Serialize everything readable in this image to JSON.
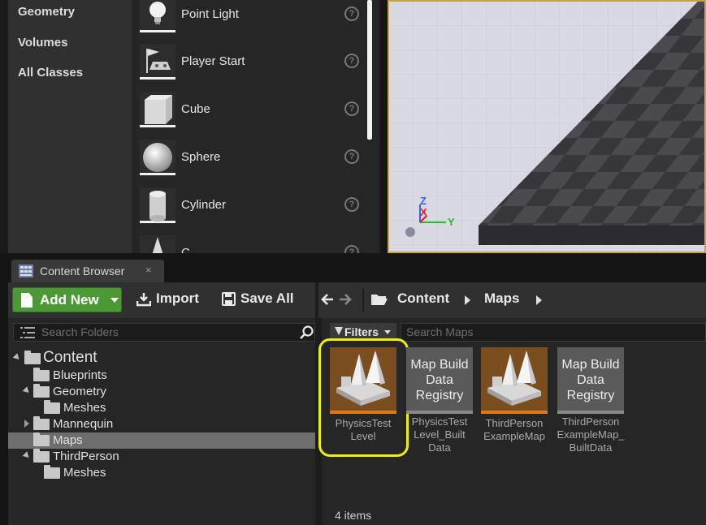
{
  "place_actors": {
    "categories": [
      "Geometry",
      "Volumes",
      "All Classes"
    ],
    "items": [
      {
        "label": "Point Light",
        "icon": "point-light-icon"
      },
      {
        "label": "Player Start",
        "icon": "player-start-icon"
      },
      {
        "label": "Cube",
        "icon": "cube-icon"
      },
      {
        "label": "Sphere",
        "icon": "sphere-icon"
      },
      {
        "label": "Cylinder",
        "icon": "cylinder-icon"
      },
      {
        "label": "C",
        "icon": "cone-icon"
      }
    ],
    "help_glyph": "?"
  },
  "viewport": {
    "axis_z": "Z",
    "axis_x": "X",
    "axis_y": "Y"
  },
  "content_browser": {
    "tab_title": "Content Browser",
    "tab_close": "×",
    "toolbar": {
      "add_new": "Add New",
      "import": "Import",
      "save_all": "Save All"
    },
    "breadcrumb": [
      "Content",
      "Maps"
    ],
    "folder_search_placeholder": "Search Folders",
    "asset_search_placeholder": "Search Maps",
    "filters_label": "Filters",
    "tree": [
      {
        "label": "Content",
        "depth": 0,
        "expanded": true,
        "selected": false
      },
      {
        "label": "Blueprints",
        "depth": 1,
        "expanded": null,
        "selected": false
      },
      {
        "label": "Geometry",
        "depth": 1,
        "expanded": true,
        "selected": false
      },
      {
        "label": "Meshes",
        "depth": 2,
        "expanded": null,
        "selected": false
      },
      {
        "label": "Mannequin",
        "depth": 1,
        "expanded": false,
        "selected": false
      },
      {
        "label": "Maps",
        "depth": 1,
        "expanded": null,
        "selected": true
      },
      {
        "label": "ThirdPerson",
        "depth": 1,
        "expanded": true,
        "selected": false
      },
      {
        "label": "Meshes",
        "depth": 2,
        "expanded": null,
        "selected": false
      }
    ],
    "assets": [
      {
        "kind": "map",
        "name_line1": "PhysicsTest",
        "name_line2": "Level",
        "name_line3": "",
        "bar_color": "#e07a10",
        "highlighted": true
      },
      {
        "kind": "registry",
        "thumb_line1": "Map Build",
        "thumb_line2": "Data",
        "thumb_line3": "Registry",
        "name_line1": "PhysicsTest",
        "name_line2": "Level_Built",
        "name_line3": "Data",
        "bar_color": "#888888",
        "highlighted": false
      },
      {
        "kind": "map",
        "name_line1": "ThirdPerson",
        "name_line2": "ExampleMap",
        "name_line3": "",
        "bar_color": "#e07a10",
        "highlighted": false
      },
      {
        "kind": "registry",
        "thumb_line1": "Map Build",
        "thumb_line2": "Data",
        "thumb_line3": "Registry",
        "name_line1": "ThirdPerson",
        "name_line2": "ExampleMap_",
        "name_line3": "BuiltData",
        "bar_color": "#888888",
        "highlighted": false
      }
    ],
    "item_count": "4 items",
    "colors": {
      "add_new_green": "#4c9a35",
      "highlight_yellow": "#f0f000",
      "viewport_border": "#c8a24a"
    }
  }
}
